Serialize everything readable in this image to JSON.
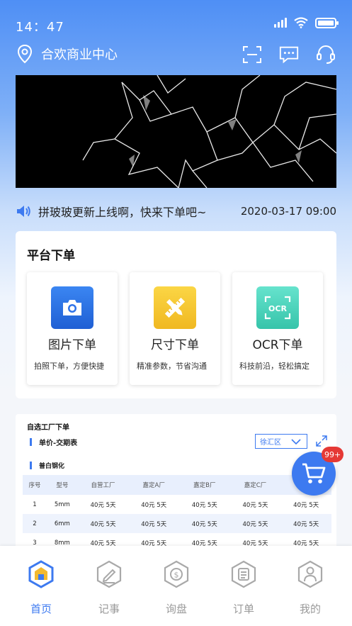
{
  "status_bar": {
    "time": "14：47"
  },
  "header": {
    "location": "合欢商业中心"
  },
  "notice": {
    "text": "拼玻玻更新上线啊，快来下单吧~",
    "date": "2020-03-17 09:00"
  },
  "platform": {
    "title": "平台下单",
    "options": [
      {
        "name": "图片下单",
        "desc": "拍照下单，方便快捷",
        "icon": "camera-icon",
        "color": "#2f73e8"
      },
      {
        "name": "尺寸下单",
        "desc": "精准参数，节省沟通",
        "icon": "ruler-pencil-icon",
        "color": "#f4c42f"
      },
      {
        "name": "OCR下单",
        "desc": "科技前沿，轻松搞定",
        "icon": "ocr-scan-icon",
        "color": "#4fd6be"
      }
    ]
  },
  "factory": {
    "title": "自选工厂下单",
    "subtitle": "单价-交期表",
    "district": "徐汇区",
    "category": "普白钢化",
    "columns": [
      "序号",
      "型号",
      "自营工厂",
      "嘉定A厂",
      "嘉定B厂",
      "嘉定C厂",
      ""
    ],
    "rows": [
      [
        "1",
        "5mm",
        "40元 5天",
        "40元 5天",
        "40元 5天",
        "40元 5天",
        "40元 5天"
      ],
      [
        "2",
        "6mm",
        "40元 5天",
        "40元 5天",
        "40元 5天",
        "40元 5天",
        "40元 5天"
      ],
      [
        "3",
        "8mm",
        "40元 5天",
        "40元 5天",
        "40元 5天",
        "40元 5天",
        "40元 5天"
      ]
    ]
  },
  "cart": {
    "badge": "99+"
  },
  "tabs": [
    {
      "label": "首页",
      "icon": "home-icon",
      "active": true
    },
    {
      "label": "记事",
      "icon": "notes-icon",
      "active": false
    },
    {
      "label": "询盘",
      "icon": "inquiry-icon",
      "active": false
    },
    {
      "label": "订单",
      "icon": "order-icon",
      "active": false
    },
    {
      "label": "我的",
      "icon": "profile-icon",
      "active": false
    }
  ],
  "colors": {
    "accent": "#3d7af0",
    "badge": "#e53935"
  }
}
